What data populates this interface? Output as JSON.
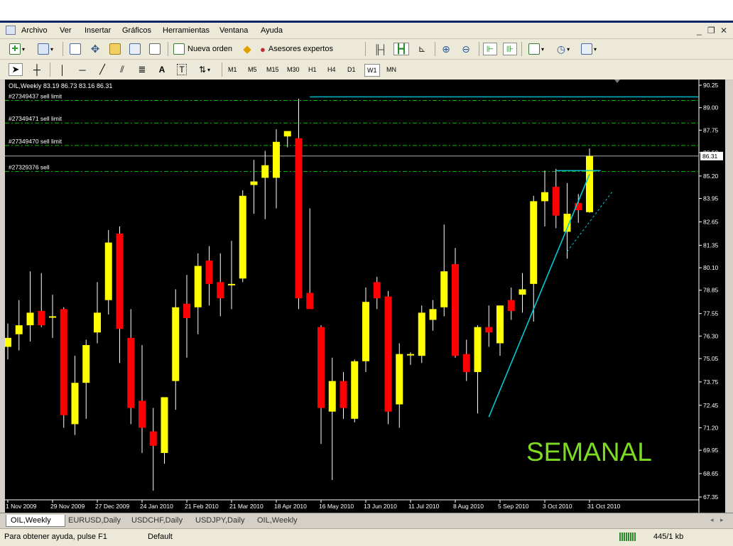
{
  "menu": [
    "Archivo",
    "Ver",
    "Insertar",
    "Gráficos",
    "Herramientas",
    "Ventana",
    "Ayuda"
  ],
  "toolbar": {
    "new_order": "Nueva orden",
    "expert_advisors": "Asesores expertos"
  },
  "timeframes": [
    "M1",
    "M5",
    "M15",
    "M30",
    "H1",
    "H4",
    "D1",
    "W1",
    "MN"
  ],
  "active_timeframe": "W1",
  "chart_header": "OIL,Weekly  83.19 86.73 83.16 86.31",
  "tabs": [
    "OIL,Weekly",
    "EURUSD,Daily",
    "USDCHF,Daily",
    "USDJPY,Daily",
    "OIL,Weekly"
  ],
  "active_tab": 0,
  "status": {
    "help": "Para obtener ayuda, pulse F1",
    "profile": "Default",
    "traffic": "445/1 kb"
  },
  "chart_data": {
    "type": "candlestick",
    "symbol": "OIL",
    "timeframe": "Weekly",
    "ylim": [
      67.35,
      90.25
    ],
    "y_ticks": [
      "90.25",
      "89.00",
      "87.75",
      "86.50",
      "85.20",
      "83.95",
      "82.65",
      "81.35",
      "80.10",
      "78.85",
      "77.55",
      "76.30",
      "75.05",
      "73.75",
      "72.45",
      "71.20",
      "69.95",
      "68.65",
      "67.35"
    ],
    "x_labels": [
      "1 Nov 2009",
      "29 Nov 2009",
      "27 Dec 2009",
      "24 Jan 2010",
      "21 Feb 2010",
      "21 Mar 2010",
      "18 Apr 2010",
      "16 May 2010",
      "13 Jun 2010",
      "11 Jul 2010",
      "8 Aug 2010",
      "5 Sep 2010",
      "3 Oct 2010",
      "31 Oct 2010"
    ],
    "current_price": "86.31",
    "watermark": "SEMANAL",
    "colors": {
      "bull": "#ffff00",
      "bear": "#ff0000",
      "background": "#000000",
      "axis": "#ffffff",
      "order_line": "#00c000",
      "trend": "#00c8d8"
    },
    "orders": [
      {
        "label": "#27349437 sell limit",
        "price": 89.4
      },
      {
        "label": "#27349471 sell limit",
        "price": 88.15
      },
      {
        "label": "#27349470 sell limit",
        "price": 86.9
      },
      {
        "label": "#27329376 sell",
        "price": 85.45
      }
    ],
    "candles": [
      {
        "o": 75.7,
        "h": 77.0,
        "l": 75.0,
        "c": 76.2
      },
      {
        "o": 76.4,
        "h": 78.3,
        "l": 75.5,
        "c": 76.9
      },
      {
        "o": 76.9,
        "h": 79.9,
        "l": 76.0,
        "c": 77.6
      },
      {
        "o": 77.7,
        "h": 79.8,
        "l": 76.8,
        "c": 76.9
      },
      {
        "o": 77.4,
        "h": 78.6,
        "l": 76.2,
        "c": 77.4
      },
      {
        "o": 77.8,
        "h": 77.9,
        "l": 71.2,
        "c": 71.9
      },
      {
        "o": 71.4,
        "h": 75.2,
        "l": 70.8,
        "c": 73.7
      },
      {
        "o": 73.7,
        "h": 76.1,
        "l": 71.7,
        "c": 75.8
      },
      {
        "o": 76.5,
        "h": 79.3,
        "l": 75.9,
        "c": 77.6
      },
      {
        "o": 78.3,
        "h": 82.2,
        "l": 77.5,
        "c": 81.5
      },
      {
        "o": 82.0,
        "h": 82.4,
        "l": 74.8,
        "c": 76.7
      },
      {
        "o": 76.2,
        "h": 77.8,
        "l": 71.4,
        "c": 72.3
      },
      {
        "o": 72.7,
        "h": 75.8,
        "l": 69.8,
        "c": 71.2
      },
      {
        "o": 71.0,
        "h": 72.3,
        "l": 67.7,
        "c": 70.2
      },
      {
        "o": 69.8,
        "h": 72.7,
        "l": 69.2,
        "c": 72.9
      },
      {
        "o": 73.8,
        "h": 78.9,
        "l": 72.2,
        "c": 77.9
      },
      {
        "o": 78.1,
        "h": 79.7,
        "l": 75.1,
        "c": 77.3
      },
      {
        "o": 77.9,
        "h": 80.9,
        "l": 76.4,
        "c": 80.2
      },
      {
        "o": 80.5,
        "h": 81.3,
        "l": 78.0,
        "c": 79.2
      },
      {
        "o": 79.3,
        "h": 80.9,
        "l": 77.4,
        "c": 78.4
      },
      {
        "o": 79.2,
        "h": 81.6,
        "l": 77.8,
        "c": 79.2
      },
      {
        "o": 79.5,
        "h": 84.4,
        "l": 79.3,
        "c": 84.1
      },
      {
        "o": 84.7,
        "h": 86.1,
        "l": 83.1,
        "c": 84.9
      },
      {
        "o": 85.1,
        "h": 86.6,
        "l": 82.8,
        "c": 85.8
      },
      {
        "o": 85.1,
        "h": 87.8,
        "l": 83.4,
        "c": 87.1
      },
      {
        "o": 87.4,
        "h": 87.5,
        "l": 86.8,
        "c": 87.7
      },
      {
        "o": 87.3,
        "h": 89.5,
        "l": 77.8,
        "c": 78.4
      },
      {
        "o": 78.7,
        "h": 83.4,
        "l": 77.9,
        "c": 77.8
      },
      {
        "o": 76.8,
        "h": 76.9,
        "l": 70.3,
        "c": 72.3
      },
      {
        "o": 72.1,
        "h": 75.1,
        "l": 68.3,
        "c": 73.8
      },
      {
        "o": 73.8,
        "h": 74.3,
        "l": 71.7,
        "c": 72.3
      },
      {
        "o": 71.7,
        "h": 75.0,
        "l": 71.5,
        "c": 74.9
      },
      {
        "o": 74.9,
        "h": 79.0,
        "l": 74.3,
        "c": 78.2
      },
      {
        "o": 79.3,
        "h": 79.6,
        "l": 77.8,
        "c": 78.4
      },
      {
        "o": 78.5,
        "h": 78.8,
        "l": 71.4,
        "c": 72.1
      },
      {
        "o": 72.5,
        "h": 75.9,
        "l": 71.2,
        "c": 75.3
      },
      {
        "o": 75.3,
        "h": 75.4,
        "l": 74.7,
        "c": 75.3
      },
      {
        "o": 75.2,
        "h": 78.0,
        "l": 74.8,
        "c": 77.6
      },
      {
        "o": 77.2,
        "h": 78.3,
        "l": 76.6,
        "c": 77.8
      },
      {
        "o": 77.9,
        "h": 82.5,
        "l": 77.4,
        "c": 79.9
      },
      {
        "o": 80.3,
        "h": 81.2,
        "l": 75.1,
        "c": 75.2
      },
      {
        "o": 75.3,
        "h": 76.1,
        "l": 73.8,
        "c": 74.3
      },
      {
        "o": 74.3,
        "h": 76.9,
        "l": 72.0,
        "c": 76.8
      },
      {
        "o": 76.8,
        "h": 78.0,
        "l": 75.7,
        "c": 76.5
      },
      {
        "o": 75.9,
        "h": 77.9,
        "l": 75.2,
        "c": 78.0
      },
      {
        "o": 78.3,
        "h": 79.0,
        "l": 77.2,
        "c": 77.7
      },
      {
        "o": 78.6,
        "h": 79.8,
        "l": 77.6,
        "c": 78.9
      },
      {
        "o": 79.2,
        "h": 84.1,
        "l": 77.1,
        "c": 83.8
      },
      {
        "o": 83.8,
        "h": 85.5,
        "l": 82.4,
        "c": 84.3
      },
      {
        "o": 84.6,
        "h": 85.6,
        "l": 82.3,
        "c": 83.0
      },
      {
        "o": 82.1,
        "h": 84.8,
        "l": 80.6,
        "c": 83.1
      },
      {
        "o": 83.7,
        "h": 84.2,
        "l": 82.6,
        "c": 83.3
      },
      {
        "o": 83.19,
        "h": 86.73,
        "l": 83.16,
        "c": 86.31
      }
    ]
  }
}
